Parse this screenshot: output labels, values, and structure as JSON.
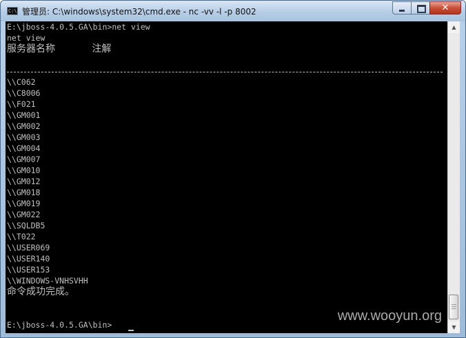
{
  "window": {
    "title": "管理员: C:\\windows\\system32\\cmd.exe - nc  -vv -l -p 8002",
    "icon_text": "C:\\",
    "icon": "console-app-icon",
    "close_glyph": "✕"
  },
  "console": {
    "lines": [
      "E:\\jboss-4.0.5.GA\\bin>net view",
      "net view",
      "服务器名称            注解",
      "",
      "\\\\C062",
      "\\\\C8006",
      "\\\\F021",
      "\\\\GM001",
      "\\\\GM002",
      "\\\\GM003",
      "\\\\GM004",
      "\\\\GM007",
      "\\\\GM010",
      "\\\\GM012",
      "\\\\GM018",
      "\\\\GM019",
      "\\\\GM022",
      "\\\\SQLDB5",
      "\\\\T022",
      "\\\\USER069",
      "\\\\USER140",
      "\\\\USER153",
      "\\\\WINDOWS-VNHSVHH",
      "命令成功完成。",
      "",
      "",
      "E:\\jboss-4.0.5.GA\\bin>"
    ]
  },
  "scrollbar": {
    "up_arrow": "▲",
    "down_arrow": "▼"
  },
  "watermark": "www.wooyun.org",
  "colors": {
    "console_bg": "#000000",
    "console_fg": "#c0c0c0",
    "title_bar": "#b9d1ea"
  }
}
